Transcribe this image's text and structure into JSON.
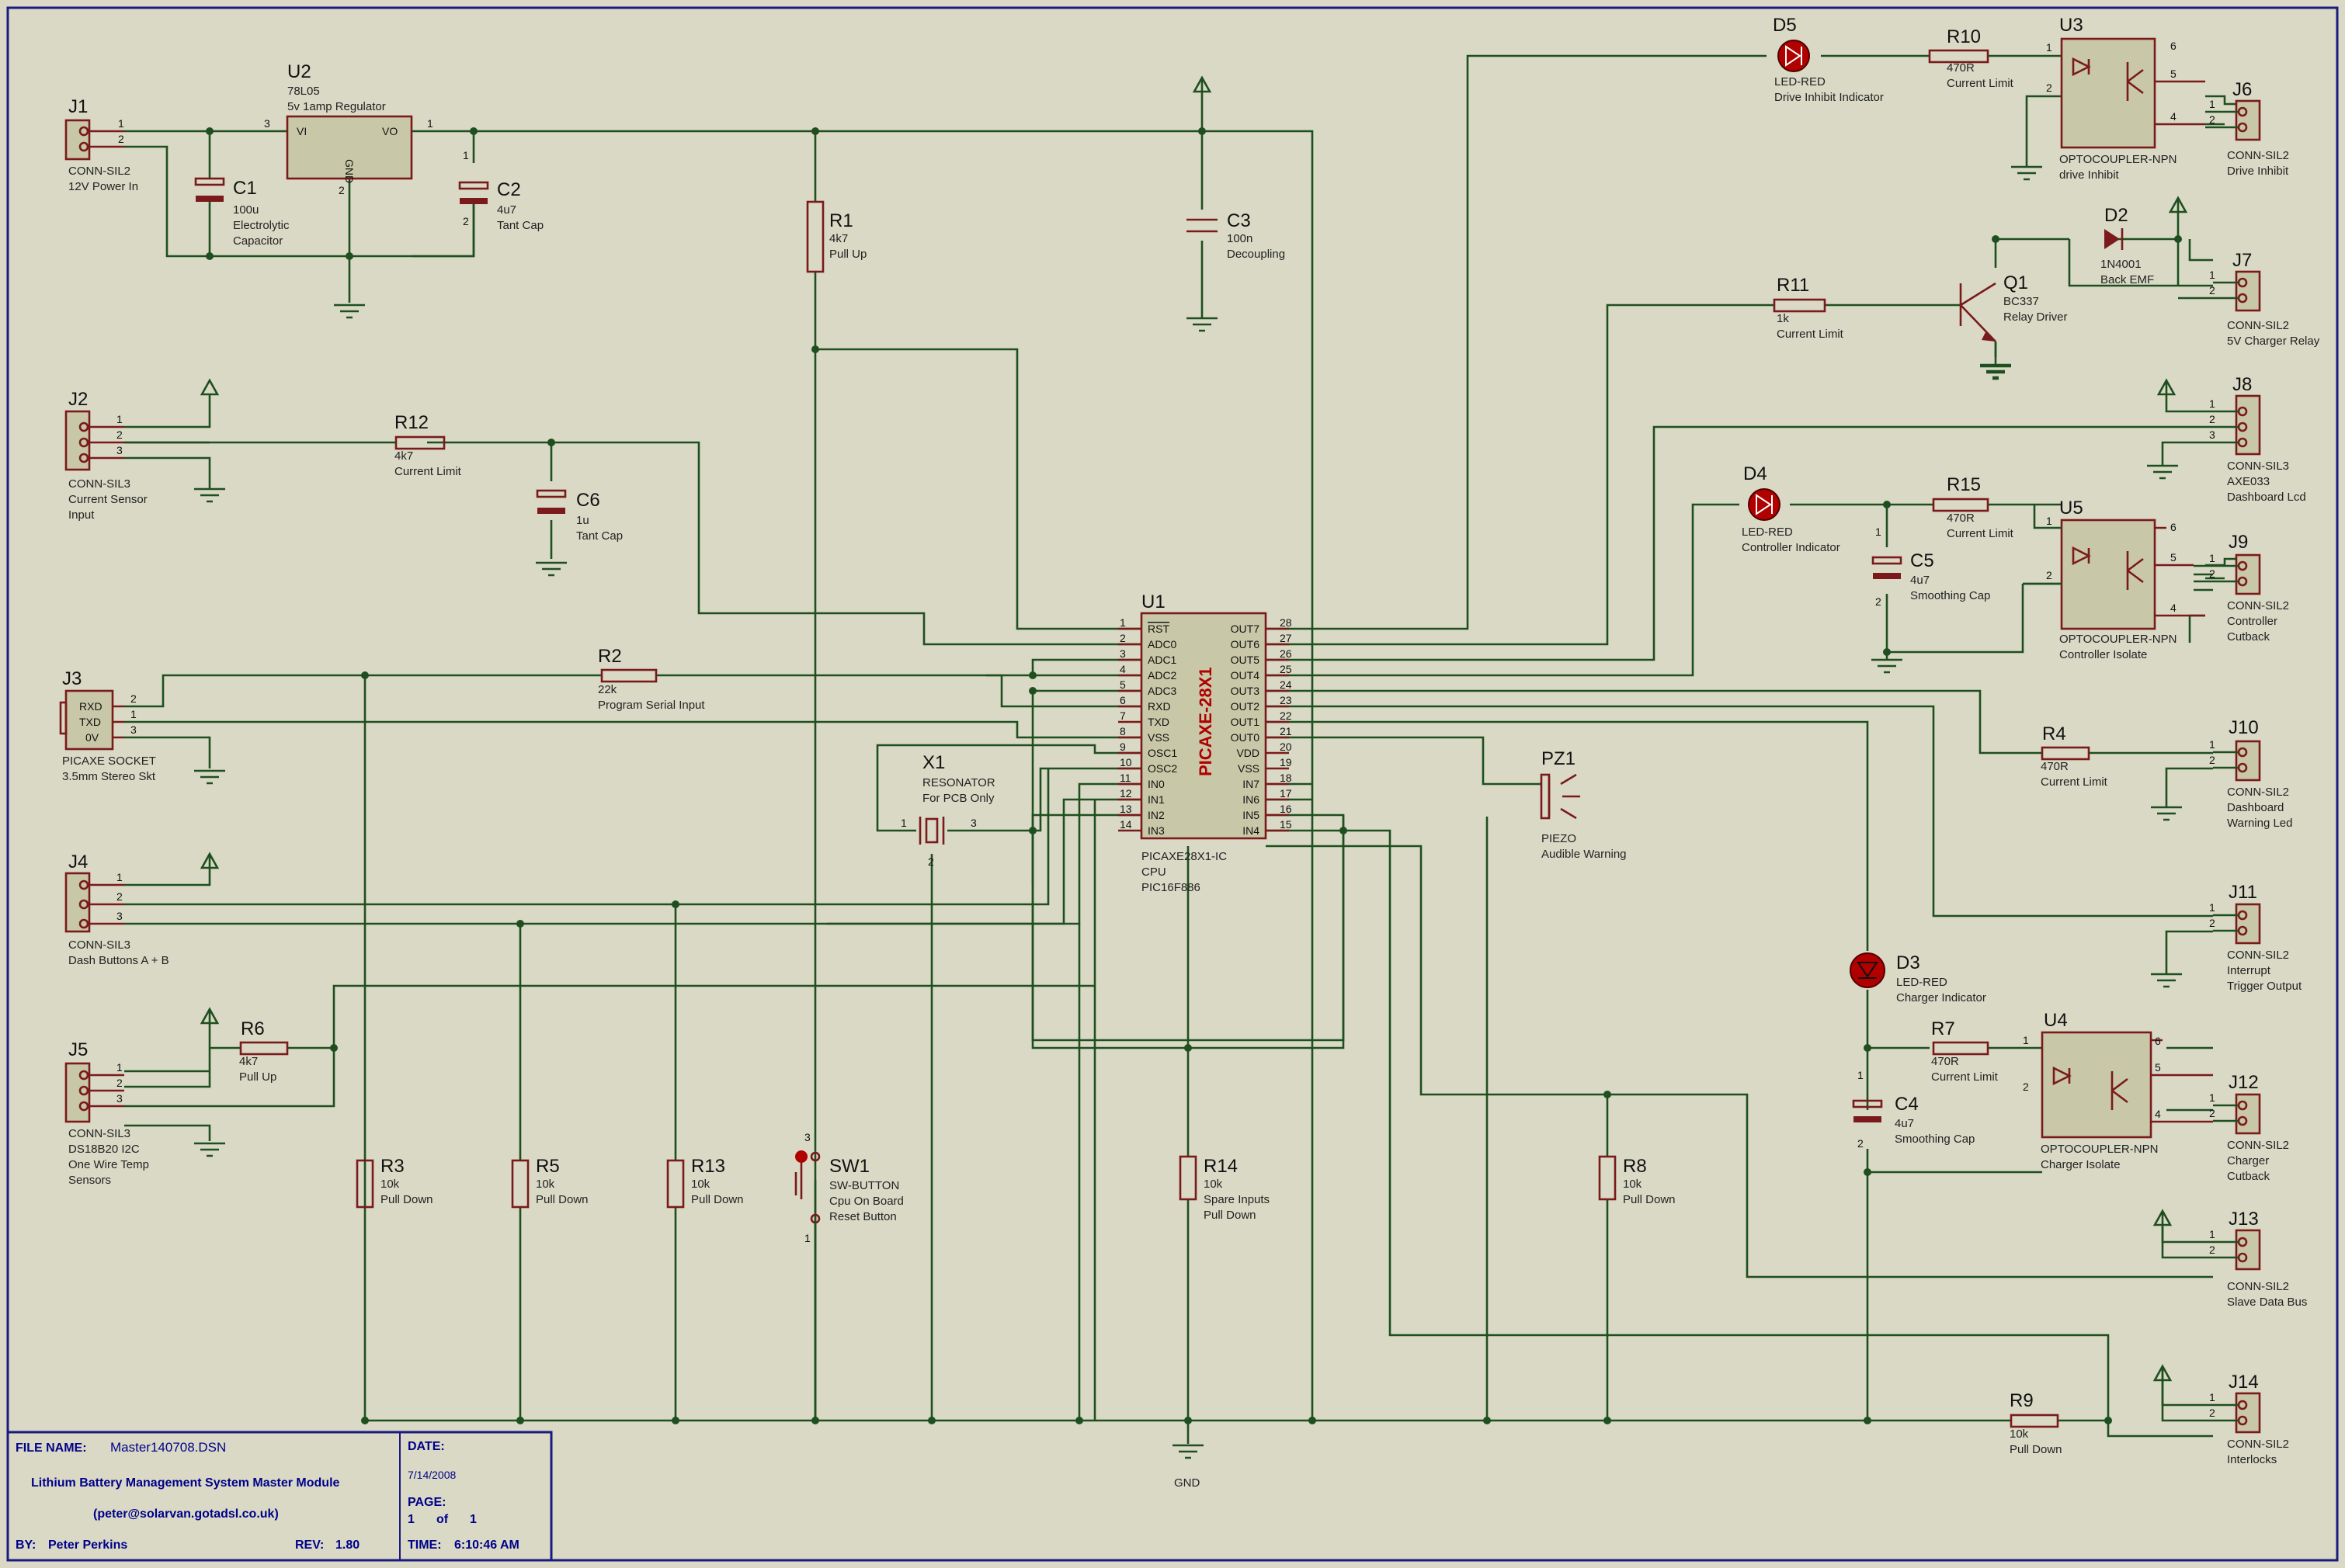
{
  "parts": {
    "j1": {
      "ref": "J1",
      "l1": "CONN-SIL2",
      "l2": "12V Power In"
    },
    "u2": {
      "ref": "U2",
      "l1": "78L05",
      "l2": "5v 1amp Regulator",
      "vi": "VI",
      "vo": "VO",
      "gnd": "GND"
    },
    "c1": {
      "ref": "C1",
      "l1": "100u",
      "l2": "Electrolytic",
      "l3": "Capacitor"
    },
    "c2": {
      "ref": "C2",
      "l1": "4u7",
      "l2": "Tant Cap"
    },
    "r1": {
      "ref": "R1",
      "l1": "4k7",
      "l2": "Pull Up"
    },
    "c3": {
      "ref": "C3",
      "l1": "100n",
      "l2": "Decoupling"
    },
    "d5": {
      "ref": "D5",
      "l1": "LED-RED",
      "l2": "Drive Inhibit Indicator"
    },
    "r10": {
      "ref": "R10",
      "l1": "470R",
      "l2": "Current Limit"
    },
    "u3": {
      "ref": "U3",
      "l1": "OPTOCOUPLER-NPN",
      "l2": "drive Inhibit"
    },
    "j6": {
      "ref": "J6",
      "l1": "CONN-SIL2",
      "l2": "Drive Inhibit"
    },
    "d2": {
      "ref": "D2",
      "l1": "1N4001",
      "l2": "Back EMF"
    },
    "q1": {
      "ref": "Q1",
      "l1": "BC337",
      "l2": "Relay Driver"
    },
    "r11": {
      "ref": "R11",
      "l1": "1k",
      "l2": "Current Limit"
    },
    "j7": {
      "ref": "J7",
      "l1": "CONN-SIL2",
      "l2": "5V Charger Relay"
    },
    "j8": {
      "ref": "J8",
      "l1": "CONN-SIL3",
      "l2": "AXE033",
      "l3": "Dashboard Lcd"
    },
    "j2": {
      "ref": "J2",
      "l1": "CONN-SIL3",
      "l2": "Current Sensor",
      "l3": "Input"
    },
    "r12": {
      "ref": "R12",
      "l1": "4k7",
      "l2": "Current Limit"
    },
    "c6": {
      "ref": "C6",
      "l1": "1u",
      "l2": "Tant Cap"
    },
    "d4": {
      "ref": "D4",
      "l1": "LED-RED",
      "l2": "Controller Indicator"
    },
    "r15": {
      "ref": "R15",
      "l1": "470R",
      "l2": "Current Limit"
    },
    "c5": {
      "ref": "C5",
      "l1": "4u7",
      "l2": "Smoothing Cap"
    },
    "u5": {
      "ref": "U5",
      "l1": "OPTOCOUPLER-NPN",
      "l2": "Controller Isolate"
    },
    "j9": {
      "ref": "J9",
      "l1": "CONN-SIL2",
      "l2": "Controller",
      "l3": "Cutback"
    },
    "j3": {
      "ref": "J3",
      "l1": "PICAXE SOCKET",
      "l2": "3.5mm Stereo Skt",
      "rxd": "RXD",
      "txd": "TXD",
      "ov": "0V"
    },
    "r2": {
      "ref": "R2",
      "l1": "22k",
      "l2": "Program Serial Input"
    },
    "u1": {
      "ref": "U1",
      "l1": "PICAXE28X1-IC",
      "l2": "CPU",
      "l3": "PIC16F886",
      "chip": "PICAXE-28X1"
    },
    "x1": {
      "ref": "X1",
      "l1": "RESONATOR",
      "l2": "For PCB Only"
    },
    "pz1": {
      "ref": "PZ1",
      "l1": "PIEZO",
      "l2": "Audible Warning"
    },
    "r4": {
      "ref": "R4",
      "l1": "470R",
      "l2": "Current Limit"
    },
    "j10": {
      "ref": "J10",
      "l1": "CONN-SIL2",
      "l2": "Dashboard",
      "l3": "Warning Led"
    },
    "j11": {
      "ref": "J11",
      "l1": "CONN-SIL2",
      "l2": "Interrupt",
      "l3": "Trigger Output"
    },
    "j4": {
      "ref": "J4",
      "l1": "CONN-SIL3",
      "l2": "Dash Buttons A + B"
    },
    "d3": {
      "ref": "D3",
      "l1": "LED-RED",
      "l2": "Charger Indicator"
    },
    "r7": {
      "ref": "R7",
      "l1": "470R",
      "l2": "Current Limit"
    },
    "u4": {
      "ref": "U4",
      "l1": "OPTOCOUPLER-NPN",
      "l2": "Charger Isolate"
    },
    "c4": {
      "ref": "C4",
      "l1": "4u7",
      "l2": "Smoothing Cap"
    },
    "j12": {
      "ref": "J12",
      "l1": "CONN-SIL2",
      "l2": "Charger",
      "l3": "Cutback"
    },
    "j5": {
      "ref": "J5",
      "l1": "CONN-SIL3",
      "l2": "DS18B20 I2C",
      "l3": "One Wire Temp",
      "l4": "Sensors"
    },
    "r6": {
      "ref": "R6",
      "l1": "4k7",
      "l2": "Pull Up"
    },
    "r3": {
      "ref": "R3",
      "l1": "10k",
      "l2": "Pull Down"
    },
    "r5": {
      "ref": "R5",
      "l1": "10k",
      "l2": "Pull Down"
    },
    "r13": {
      "ref": "R13",
      "l1": "10k",
      "l2": "Pull Down"
    },
    "sw1": {
      "ref": "SW1",
      "l1": "SW-BUTTON",
      "l2": "Cpu On Board",
      "l3": "Reset Button"
    },
    "r14": {
      "ref": "R14",
      "l1": "10k",
      "l2": "Spare Inputs",
      "l3": "Pull Down"
    },
    "r8": {
      "ref": "R8",
      "l1": "10k",
      "l2": "Pull Down"
    },
    "j13": {
      "ref": "J13",
      "l1": "CONN-SIL2",
      "l2": "Slave Data Bus"
    },
    "r9": {
      "ref": "R9",
      "l1": "10k",
      "l2": "Pull Down"
    },
    "j14": {
      "ref": "J14",
      "l1": "CONN-SIL2",
      "l2": "Interlocks"
    },
    "gnd": {
      "label": "GND"
    }
  },
  "u1_pins_left": [
    {
      "n": "1",
      "name": "RST"
    },
    {
      "n": "2",
      "name": "ADC0"
    },
    {
      "n": "3",
      "name": "ADC1"
    },
    {
      "n": "4",
      "name": "ADC2"
    },
    {
      "n": "5",
      "name": "ADC3"
    },
    {
      "n": "6",
      "name": "RXD"
    },
    {
      "n": "7",
      "name": "TXD"
    },
    {
      "n": "8",
      "name": "VSS"
    },
    {
      "n": "9",
      "name": "OSC1"
    },
    {
      "n": "10",
      "name": "OSC2"
    },
    {
      "n": "11",
      "name": "IN0"
    },
    {
      "n": "12",
      "name": "IN1"
    },
    {
      "n": "13",
      "name": "IN2"
    },
    {
      "n": "14",
      "name": "IN3"
    }
  ],
  "u1_pins_right": [
    {
      "n": "28",
      "name": "OUT7"
    },
    {
      "n": "27",
      "name": "OUT6"
    },
    {
      "n": "26",
      "name": "OUT5"
    },
    {
      "n": "25",
      "name": "OUT4"
    },
    {
      "n": "24",
      "name": "OUT3"
    },
    {
      "n": "23",
      "name": "OUT2"
    },
    {
      "n": "22",
      "name": "OUT1"
    },
    {
      "n": "21",
      "name": "OUT0"
    },
    {
      "n": "20",
      "name": "VDD"
    },
    {
      "n": "19",
      "name": "VSS"
    },
    {
      "n": "18",
      "name": "IN7"
    },
    {
      "n": "17",
      "name": "IN6"
    },
    {
      "n": "16",
      "name": "IN5"
    },
    {
      "n": "15",
      "name": "IN4"
    }
  ],
  "title_block": {
    "file_name_label": "FILE NAME:",
    "file_name": "Master140708.DSN",
    "title": "Lithium Battery Management System Master Module",
    "email": "(peter@solarvan.gotadsl.co.uk)",
    "by_label": "BY:",
    "by": "Peter Perkins",
    "rev_label": "REV:",
    "rev": "1.80",
    "date_label": "DATE:",
    "date": "7/14/2008",
    "page_label": "PAGE:",
    "page": "1",
    "of_label": "of",
    "pages": "1",
    "time_label": "TIME:",
    "time": "6:10:46 AM"
  }
}
